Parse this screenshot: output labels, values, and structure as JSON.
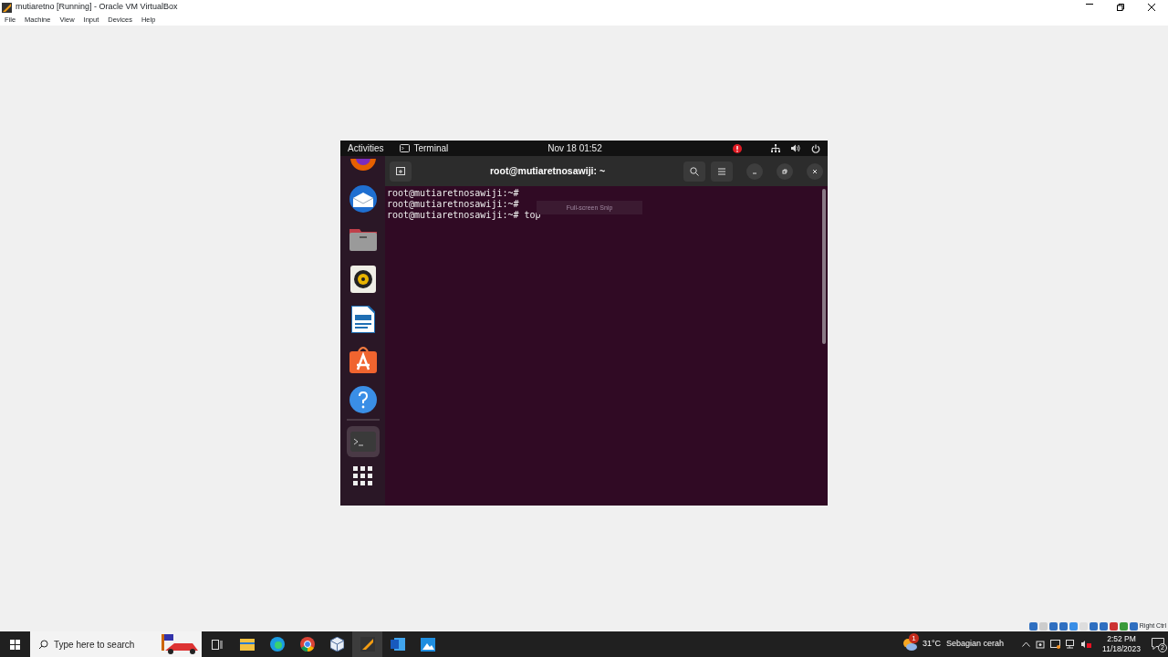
{
  "window": {
    "title": "mutiaretno [Running] - Oracle VM VirtualBox"
  },
  "menu": [
    "File",
    "Machine",
    "View",
    "Input",
    "Devices",
    "Help"
  ],
  "guest": {
    "topbar": {
      "activities": "Activities",
      "app": "Terminal",
      "clock": "Nov 18  01:52"
    },
    "dock": [
      {
        "selected": false
      },
      {
        "selected": false
      },
      {
        "selected": false
      },
      {
        "selected": false
      },
      {
        "selected": false
      },
      {
        "selected": false
      },
      {
        "selected": false
      },
      {
        "selected": true
      }
    ],
    "terminal": {
      "title": "root@mutiaretnosawiji: ~",
      "lines": [
        {
          "prompt": "root@mutiaretnosawiji:~#"
        },
        {
          "prompt": "root@mutiaretnosawiji:~#"
        },
        {
          "prompt": "root@mutiaretnosawiji:~#",
          "command": "top"
        }
      ],
      "tooltip": "Full-screen Snip"
    }
  },
  "vm_status": {
    "host_key": "Right Ctrl"
  },
  "taskbar": {
    "search_placeholder": "Type here to search",
    "apps": [
      {
        "selected": false
      },
      {
        "selected": false
      },
      {
        "selected": false
      },
      {
        "selected": false
      },
      {
        "selected": false
      },
      {
        "selected": true
      },
      {
        "selected": false
      },
      {
        "selected": false
      }
    ],
    "weather": {
      "badge": "1",
      "temperature": "31°C",
      "condition": "Sebagian cerah"
    },
    "time": "2:52 PM",
    "date": "11/18/2023",
    "notifications": "2"
  }
}
